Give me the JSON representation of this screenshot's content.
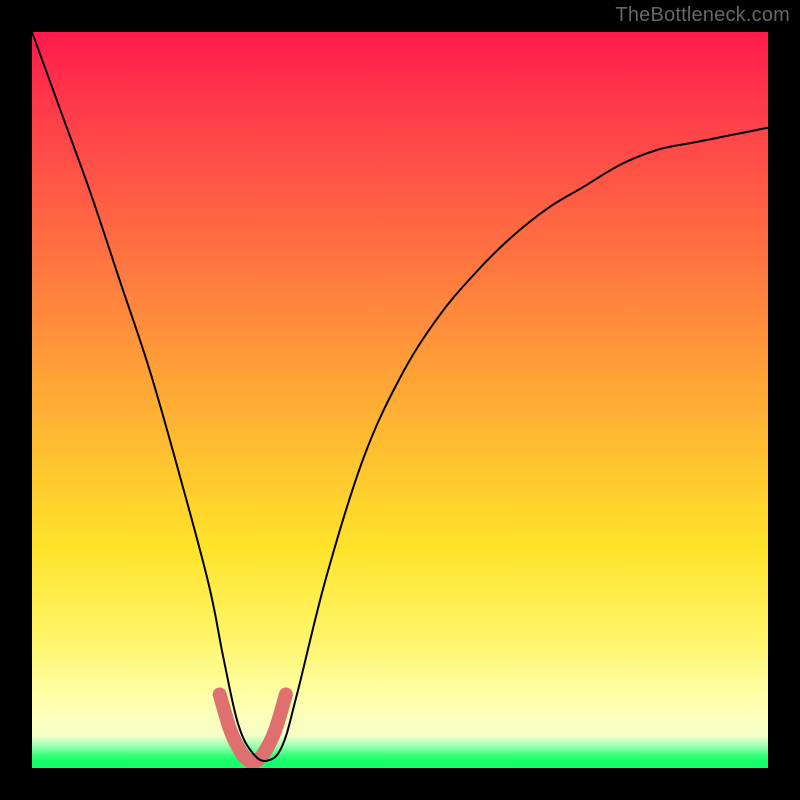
{
  "watermark": "TheBottleneck.com",
  "chart_data": {
    "type": "line",
    "title": "",
    "xlabel": "",
    "ylabel": "",
    "xlim": [
      0,
      100
    ],
    "ylim": [
      0,
      100
    ],
    "legend": false,
    "grid": false,
    "background": "vertical-rainbow-gradient",
    "series": [
      {
        "name": "black-curve",
        "stroke": "#000000",
        "x": [
          0,
          4,
          8,
          12,
          16,
          20,
          24,
          26,
          28,
          30,
          32,
          34,
          36,
          40,
          45,
          50,
          55,
          60,
          65,
          70,
          75,
          80,
          85,
          90,
          95,
          100
        ],
        "values": [
          100,
          89,
          78,
          66,
          54,
          40,
          25,
          15,
          6,
          2,
          1,
          3,
          10,
          26,
          42,
          53,
          61,
          67,
          72,
          76,
          79,
          82,
          84,
          85,
          86,
          87
        ]
      },
      {
        "name": "valley-highlight",
        "stroke": "#e07070",
        "x": [
          25.5,
          27,
          28.5,
          29.5,
          30,
          30.5,
          31.5,
          33,
          34.5
        ],
        "values": [
          10,
          5,
          2,
          1,
          0.8,
          1,
          2,
          5,
          10
        ]
      }
    ],
    "annotations": [
      {
        "text": "TheBottleneck.com",
        "position": "top-right",
        "color": "#666666"
      }
    ]
  }
}
